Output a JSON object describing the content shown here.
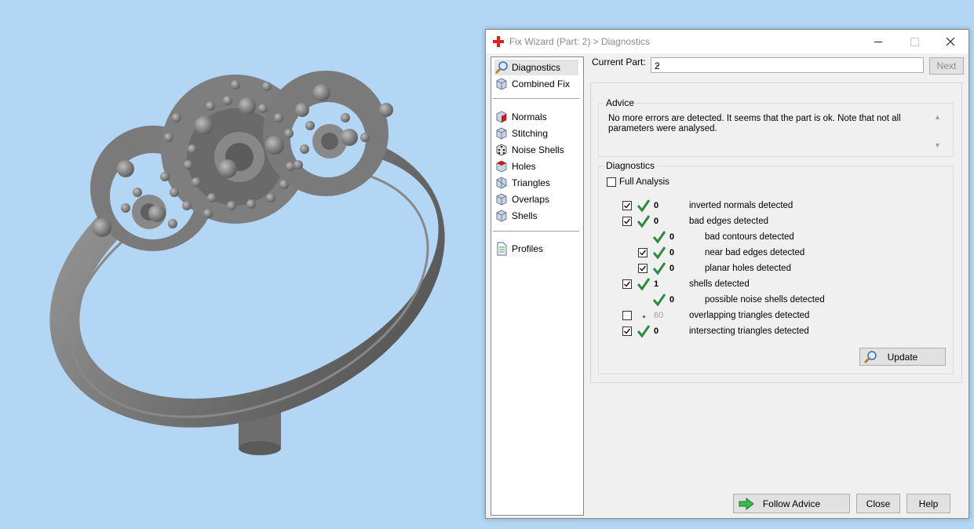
{
  "window": {
    "title": "Fix Wizard (Part: 2) > Diagnostics"
  },
  "sidebar": {
    "items": [
      {
        "label": "Diagnostics",
        "icon": "magnifier-icon",
        "selected": true
      },
      {
        "label": "Combined Fix",
        "icon": "cube-icon"
      },
      {
        "label": "Normals",
        "icon": "cube-red-icon"
      },
      {
        "label": "Stitching",
        "icon": "cube-icon"
      },
      {
        "label": "Noise Shells",
        "icon": "dice-icon"
      },
      {
        "label": "Holes",
        "icon": "cube-red-icon"
      },
      {
        "label": "Triangles",
        "icon": "cube-icon"
      },
      {
        "label": "Overlaps",
        "icon": "cube-icon"
      },
      {
        "label": "Shells",
        "icon": "cube-icon"
      },
      {
        "label": "Profiles",
        "icon": "document-icon"
      }
    ]
  },
  "current_part": {
    "label": "Current Part:",
    "value": "2",
    "next_label": "Next"
  },
  "advice": {
    "title": "Advice",
    "text": "No more errors are detected. It seems that the part is ok. Note that not all parameters were analysed."
  },
  "diagnostics": {
    "title": "Diagnostics",
    "full_analysis_label": "Full Analysis",
    "full_analysis_checked": false,
    "rows": [
      {
        "checked": true,
        "status": "ok",
        "value": "0",
        "label": "inverted normals detected"
      },
      {
        "checked": true,
        "status": "ok",
        "value": "0",
        "label": "bad edges detected"
      },
      {
        "checked": null,
        "status": "ok",
        "value": "0",
        "label": "bad contours detected"
      },
      {
        "checked": true,
        "status": "ok",
        "value": "0",
        "label": "near bad edges detected"
      },
      {
        "checked": true,
        "status": "ok",
        "value": "0",
        "label": "planar holes detected"
      },
      {
        "checked": true,
        "status": "ok",
        "value": "1",
        "label": "shells detected"
      },
      {
        "checked": null,
        "status": "ok",
        "value": "0",
        "label": "possible noise shells detected"
      },
      {
        "checked": false,
        "status": "pending",
        "value": "60",
        "label": "overlapping triangles detected"
      },
      {
        "checked": true,
        "status": "ok",
        "value": "0",
        "label": "intersecting triangles detected"
      }
    ],
    "update_label": "Update"
  },
  "footer": {
    "follow_advice_label": "Follow Advice",
    "close_label": "Close",
    "help_label": "Help"
  },
  "colors": {
    "viewport_background": "#b3d6f4",
    "model": "#6f6f6f",
    "check_green": "#2e8b3a"
  }
}
